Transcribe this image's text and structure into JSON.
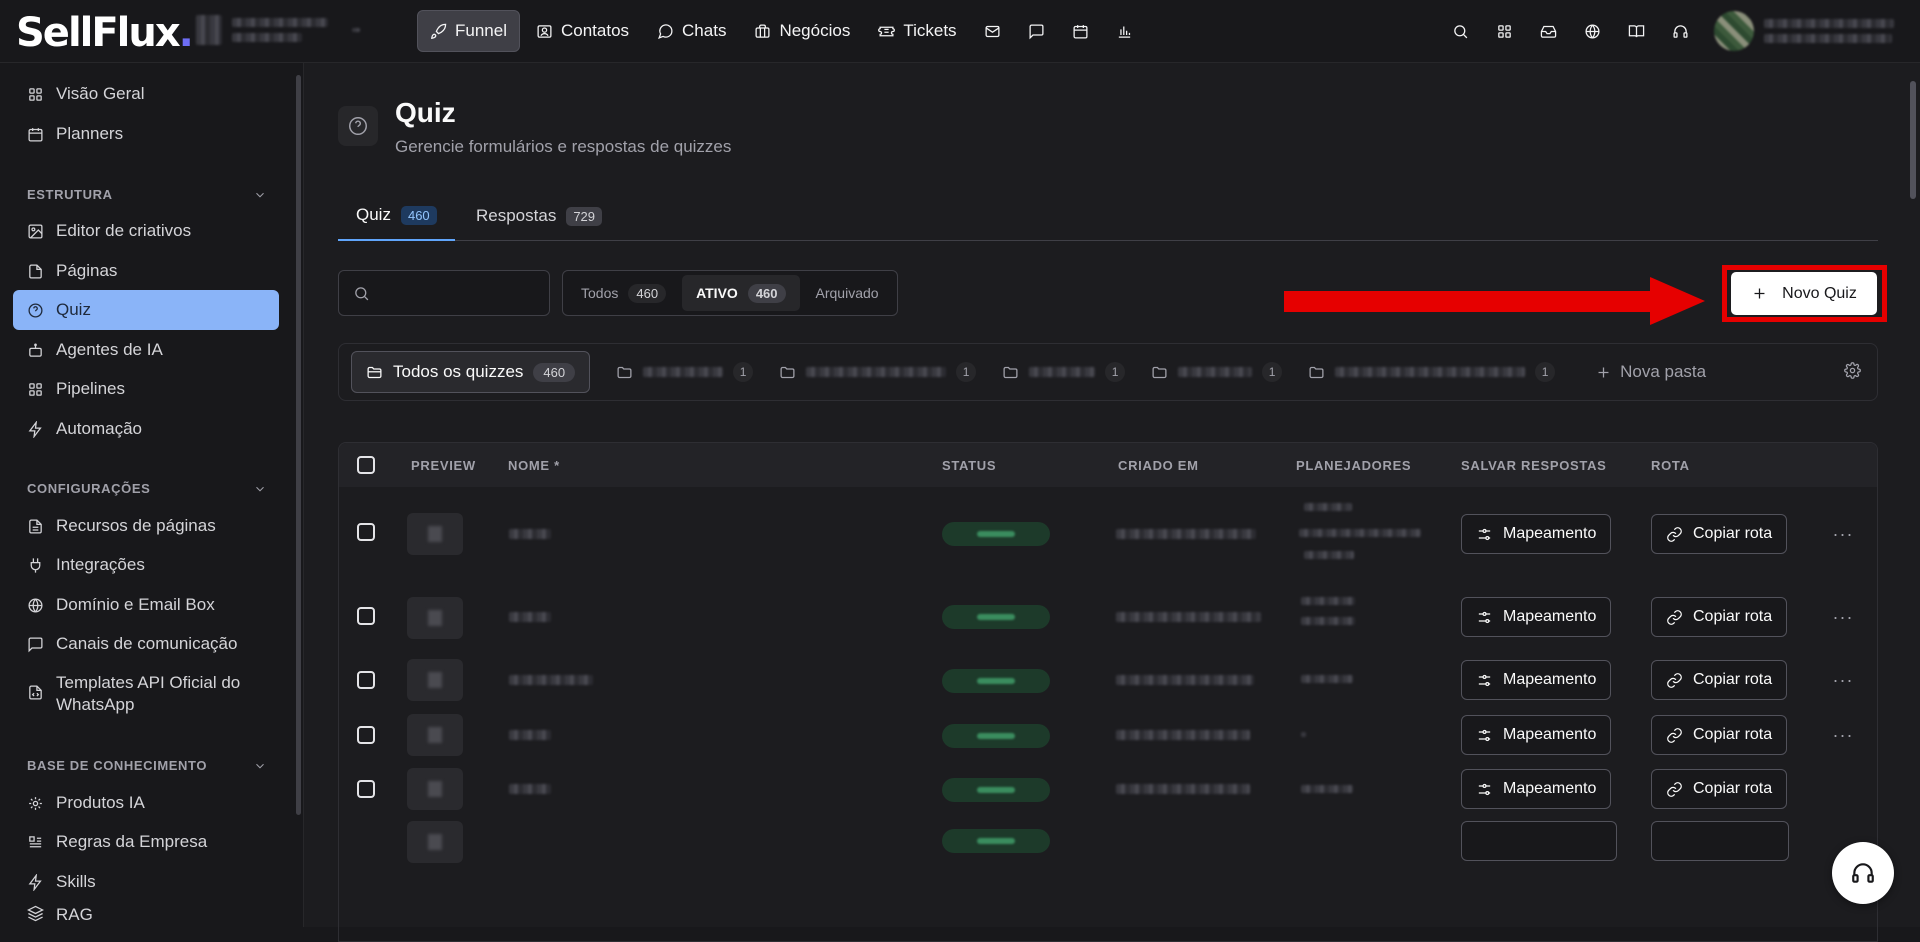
{
  "app": {
    "logo_text": "SellFlux",
    "logo_dot": "."
  },
  "nav": {
    "items": [
      {
        "label": "Funnel",
        "icon": "rocket-icon",
        "active": true
      },
      {
        "label": "Contatos",
        "icon": "contacts-icon"
      },
      {
        "label": "Chats",
        "icon": "chat-bubble-icon"
      },
      {
        "label": "Negócios",
        "icon": "briefcase-icon"
      },
      {
        "label": "Tickets",
        "icon": "ticket-icon"
      }
    ],
    "extra_icons": [
      "mail-icon",
      "message-square-icon",
      "calendar-icon",
      "bar-chart-icon"
    ],
    "right_icons": [
      "search-icon",
      "apps-grid-icon",
      "inbox-icon",
      "globe-icon",
      "book-icon",
      "headset-icon"
    ]
  },
  "sidebar": {
    "top_items": [
      {
        "label": "Visão Geral",
        "icon": "grid-icon"
      },
      {
        "label": "Planners",
        "icon": "calendar-icon"
      }
    ],
    "sections": [
      {
        "title": "ESTRUTURA",
        "items": [
          {
            "label": "Editor de criativos",
            "icon": "image-edit-icon"
          },
          {
            "label": "Páginas",
            "icon": "file-icon"
          },
          {
            "label": "Quiz",
            "icon": "help-circle-icon",
            "active": true
          },
          {
            "label": "Agentes de IA",
            "icon": "bot-icon"
          },
          {
            "label": "Pipelines",
            "icon": "grid-icon"
          },
          {
            "label": "Automação",
            "icon": "zap-icon"
          }
        ]
      },
      {
        "title": "CONFIGURAÇÕES",
        "items": [
          {
            "label": "Recursos de páginas",
            "icon": "file-text-icon"
          },
          {
            "label": "Integrações",
            "icon": "plug-icon"
          },
          {
            "label": "Domínio e Email Box",
            "icon": "globe-icon"
          },
          {
            "label": "Canais de comunicação",
            "icon": "message-square-icon"
          },
          {
            "label": "Templates API Oficial do WhatsApp",
            "icon": "file-code-icon"
          }
        ]
      },
      {
        "title": "BASE DE CONHECIMENTO",
        "items": [
          {
            "label": "Produtos IA",
            "icon": "cog-box-icon"
          },
          {
            "label": "Regras da Empresa",
            "icon": "list-icon"
          },
          {
            "label": "Skills",
            "icon": "zap-icon"
          },
          {
            "label": "RAG",
            "icon": "layers-icon"
          }
        ]
      }
    ]
  },
  "page": {
    "title": "Quiz",
    "subtitle": "Gerencie formulários e respostas de quizzes",
    "tabs": [
      {
        "label": "Quiz",
        "count": "460",
        "active": true
      },
      {
        "label": "Respostas",
        "count": "729"
      }
    ],
    "search_placeholder": "",
    "filters": [
      {
        "label": "Todos",
        "count": "460"
      },
      {
        "label": "ATIVO",
        "count": "460",
        "active": true
      },
      {
        "label": "Arquivado",
        "count": ""
      }
    ],
    "new_button": "Novo Quiz",
    "folders": {
      "all_label": "Todos os quizzes",
      "all_count": "460",
      "items": [
        {
          "count": "1"
        },
        {
          "count": "1"
        },
        {
          "count": "1"
        },
        {
          "count": "1"
        },
        {
          "count": "1"
        }
      ],
      "new_folder": "Nova pasta"
    }
  },
  "table": {
    "columns": [
      "PREVIEW",
      "NOME *",
      "STATUS",
      "CRIADO EM",
      "PLANEJADORES",
      "SALVAR RESPOSTAS",
      "ROTA"
    ],
    "action_mapping": "Mapeamento",
    "action_copy": "Copiar rota",
    "more": "···"
  },
  "colors": {
    "accent": "#8ab4f8",
    "highlight_red": "#e60000",
    "status_green": "#3b8d5f"
  }
}
